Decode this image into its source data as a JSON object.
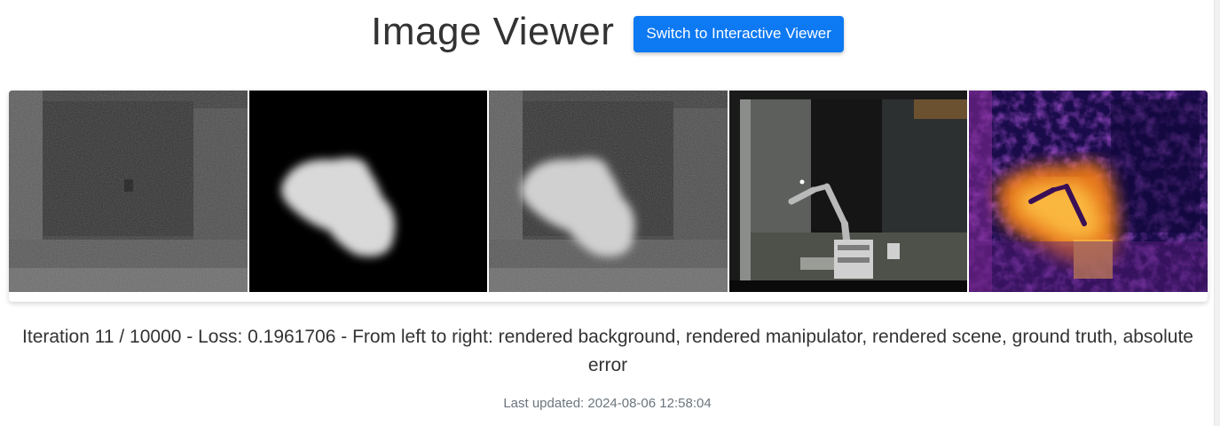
{
  "header": {
    "title": "Image Viewer",
    "switch_button_label": "Switch to Interactive Viewer"
  },
  "colors": {
    "button_bg": "#0d79f2",
    "title_text": "#333333",
    "muted_text": "#6c757d"
  },
  "images": [
    {
      "name": "rendered-background-image",
      "kind": "rendered background"
    },
    {
      "name": "rendered-manipulator-image",
      "kind": "rendered manipulator"
    },
    {
      "name": "rendered-scene-image",
      "kind": "rendered scene"
    },
    {
      "name": "ground-truth-image",
      "kind": "ground truth"
    },
    {
      "name": "absolute-error-image",
      "kind": "absolute error"
    }
  ],
  "status": {
    "caption": "Iteration 11 / 10000 - Loss: 0.1961706 - From left to right: rendered background, rendered manipulator, rendered scene, ground truth, absolute error",
    "last_updated": "Last updated: 2024-08-06 12:58:04"
  }
}
